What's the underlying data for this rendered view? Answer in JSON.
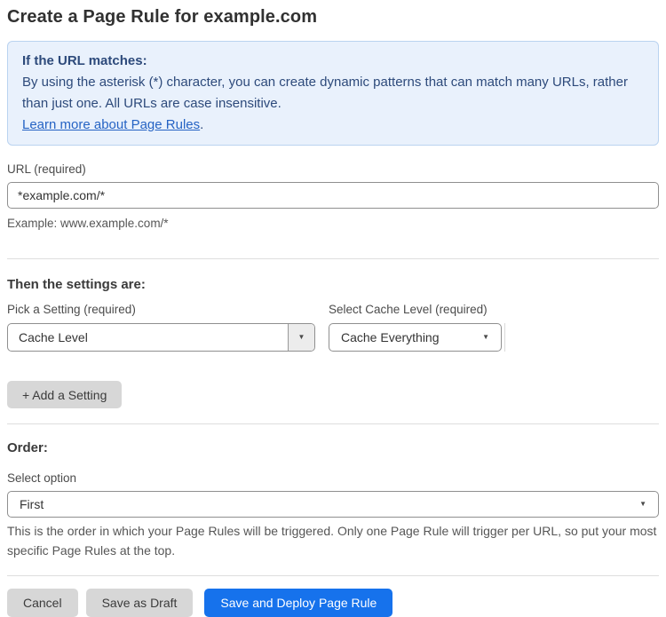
{
  "page": {
    "title": "Create a Page Rule for example.com"
  },
  "info_box": {
    "heading": "If the URL matches:",
    "body": "By using the asterisk (*) character, you can create dynamic patterns that can match many URLs, rather than just one. All URLs are case insensitive.",
    "link_label": "Learn more about Page Rules",
    "link_suffix": "."
  },
  "url_field": {
    "label": "URL (required)",
    "value": "*example.com/*",
    "helper": "Example: www.example.com/*"
  },
  "settings_section": {
    "heading": "Then the settings are:",
    "setting_picker": {
      "label": "Pick a Setting (required)",
      "value": "Cache Level"
    },
    "cache_level_picker": {
      "label": "Select Cache Level (required)",
      "value": "Cache Everything"
    },
    "add_setting_label": "+ Add a Setting"
  },
  "order_section": {
    "heading": "Order:",
    "select_label": "Select option",
    "select_value": "First",
    "helper": "This is the order in which your Page Rules will be triggered. Only one Page Rule will trigger per URL, so put your most specific Page Rules at the top."
  },
  "footer": {
    "cancel_label": "Cancel",
    "save_draft_label": "Save as Draft",
    "save_deploy_label": "Save and Deploy Page Rule"
  },
  "icons": {
    "dropdown_arrow": "▼"
  },
  "colors": {
    "accent_blue": "#1672ec",
    "info_bg": "#e9f1fc",
    "info_border": "#bad3f0",
    "info_text": "#2d4a7b",
    "link_blue": "#2563c4",
    "button_gray": "#d7d7d7"
  }
}
